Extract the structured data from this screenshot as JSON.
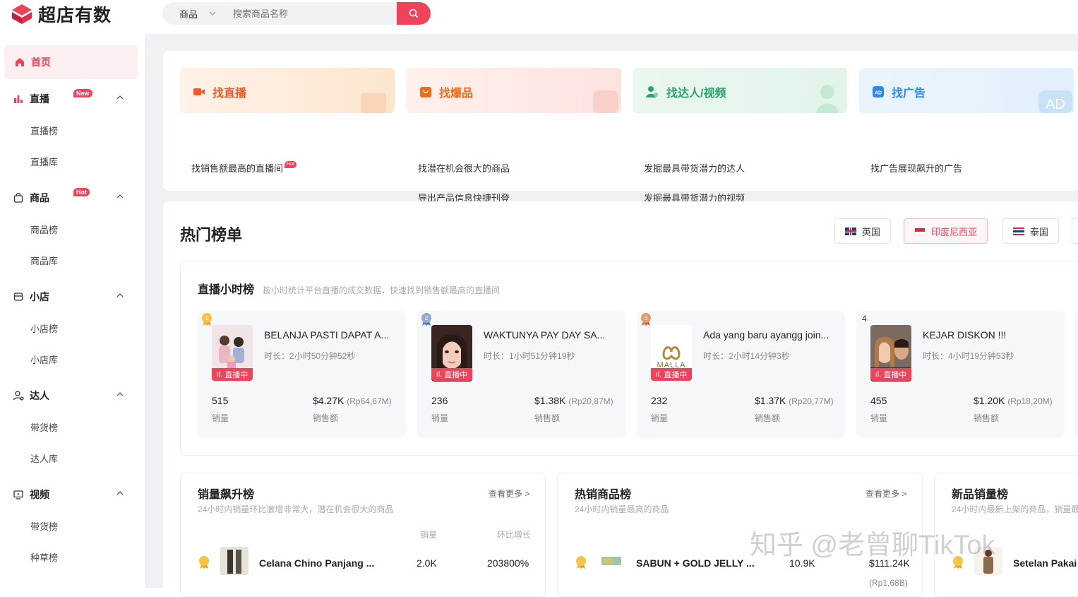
{
  "app": {
    "brand": "超店有数",
    "brand_color": "#f0435a"
  },
  "search": {
    "type_label": "商品",
    "placeholder": "搜索商品名称"
  },
  "sidebar": {
    "home": "首页",
    "groups": [
      {
        "label": "直播",
        "icon": "bar-chart-icon",
        "badge": "New",
        "items": [
          "直播榜",
          "直播库"
        ]
      },
      {
        "label": "商品",
        "icon": "shopping-bag-icon",
        "badge": "Hot",
        "items": [
          "商品榜",
          "商品库"
        ]
      },
      {
        "label": "小店",
        "icon": "store-icon",
        "badge": "",
        "items": [
          "小店榜",
          "小店库"
        ]
      },
      {
        "label": "达人",
        "icon": "user-icon",
        "badge": "",
        "items": [
          "带货榜",
          "达人库"
        ]
      },
      {
        "label": "视频",
        "icon": "monitor-icon",
        "badge": "",
        "items": [
          "带货榜",
          "种草榜"
        ]
      }
    ]
  },
  "features": [
    {
      "title": "找直播",
      "icon": "video-icon",
      "color": "#f05a2a",
      "links": [
        "找销售额最高的直播间"
      ],
      "hot": "Hot"
    },
    {
      "title": "找爆品",
      "icon": "bag-icon",
      "color": "#f06a1a",
      "links": [
        "找潜在机会很大的商品",
        "导出产品信息快捷刊登"
      ]
    },
    {
      "title": "找达人/视频",
      "icon": "person-icon",
      "color": "#2aa36a",
      "links": [
        "发掘最具带货潜力的达人",
        "发掘最具带货潜力的视频"
      ]
    },
    {
      "title": "找广告",
      "icon": "ad-icon",
      "color": "#2a88f0",
      "links": [
        "找广告展现飙升的广告"
      ]
    }
  ],
  "ranking": {
    "title": "热门榜单",
    "countries": [
      {
        "label": "英国",
        "active": false
      },
      {
        "label": "印度尼西亚",
        "active": true
      },
      {
        "label": "泰国",
        "active": false
      }
    ],
    "live": {
      "title": "直播小时榜",
      "subtitle": "按小时统计平台直播的成交数据，快速找到销售额最高的直播间",
      "badge": "直播中",
      "sales_label": "销量",
      "revenue_label": "销售额",
      "duration_prefix": "时长：",
      "items": [
        {
          "rank": "1",
          "name": "BELANJA PASTI DAPAT A...",
          "duration": "2小时50分钟52秒",
          "sales": "515",
          "revenue": "$4.27K",
          "revenue_local": "(Rp64,67M)"
        },
        {
          "rank": "2",
          "name": "WAKTUNYA PAY DAY SA...",
          "duration": "1小时51分钟19秒",
          "sales": "236",
          "revenue": "$1.38K",
          "revenue_local": "(Rp20,87M)"
        },
        {
          "rank": "3",
          "name": "Ada yang baru ayangg join...",
          "duration": "2小时14分钟3秒",
          "sales": "232",
          "revenue": "$1.37K",
          "revenue_local": "(Rp20,77M)"
        },
        {
          "rank": "4",
          "name": "KEJAR DISKON !!!",
          "duration": "4小时19分钟53秒",
          "sales": "455",
          "revenue": "$1.20K",
          "revenue_local": "(Rp18,20M)"
        }
      ],
      "logo_text": "MALLA"
    },
    "lists": [
      {
        "title": "销量飙升榜",
        "subtitle": "24小时内销量环比激增非常大，潜在机会很大的商品",
        "more": "查看更多 >",
        "col1": "销量",
        "col2": "环比增长",
        "row": {
          "name": "Celana Chino Panjang ...",
          "v1": "2.0K",
          "v2": "203800%"
        }
      },
      {
        "title": "热销商品榜",
        "subtitle": "24小时内销量最高的商品",
        "more": "查看更多 >",
        "row": {
          "name": "SABUN + GOLD JELLY ...",
          "v1": "10.9K",
          "v2": "$111.24K",
          "v3": "(Rp1,68B)"
        }
      },
      {
        "title": "新品销量榜",
        "subtitle": "24小时内最新上架的商品，销量最",
        "row": {
          "name": "Setelan Pakai"
        }
      }
    ]
  },
  "watermark": "知乎 @老曾聊TikTok"
}
